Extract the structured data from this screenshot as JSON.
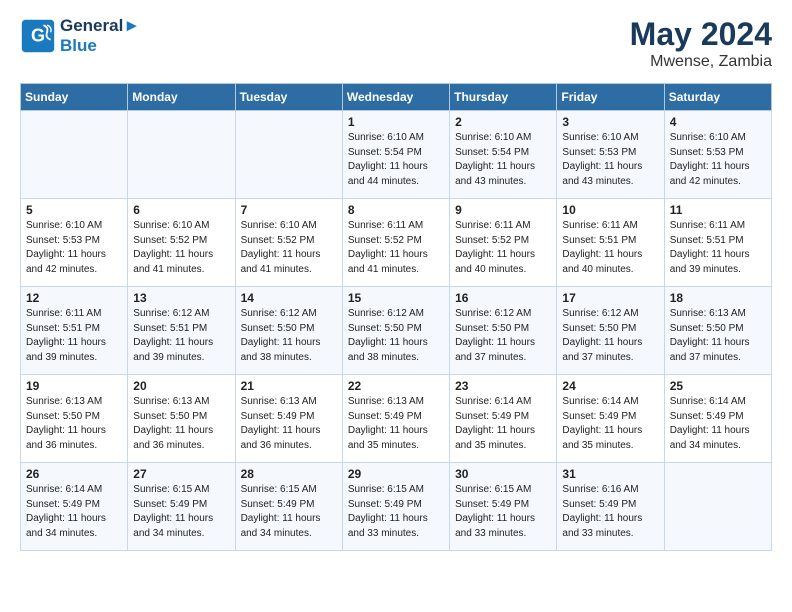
{
  "header": {
    "logo_line1": "General",
    "logo_line2": "Blue",
    "month": "May 2024",
    "location": "Mwense, Zambia"
  },
  "weekdays": [
    "Sunday",
    "Monday",
    "Tuesday",
    "Wednesday",
    "Thursday",
    "Friday",
    "Saturday"
  ],
  "weeks": [
    [
      {
        "day": "",
        "info": ""
      },
      {
        "day": "",
        "info": ""
      },
      {
        "day": "",
        "info": ""
      },
      {
        "day": "1",
        "info": "Sunrise: 6:10 AM\nSunset: 5:54 PM\nDaylight: 11 hours\nand 44 minutes."
      },
      {
        "day": "2",
        "info": "Sunrise: 6:10 AM\nSunset: 5:54 PM\nDaylight: 11 hours\nand 43 minutes."
      },
      {
        "day": "3",
        "info": "Sunrise: 6:10 AM\nSunset: 5:53 PM\nDaylight: 11 hours\nand 43 minutes."
      },
      {
        "day": "4",
        "info": "Sunrise: 6:10 AM\nSunset: 5:53 PM\nDaylight: 11 hours\nand 42 minutes."
      }
    ],
    [
      {
        "day": "5",
        "info": "Sunrise: 6:10 AM\nSunset: 5:53 PM\nDaylight: 11 hours\nand 42 minutes."
      },
      {
        "day": "6",
        "info": "Sunrise: 6:10 AM\nSunset: 5:52 PM\nDaylight: 11 hours\nand 41 minutes."
      },
      {
        "day": "7",
        "info": "Sunrise: 6:10 AM\nSunset: 5:52 PM\nDaylight: 11 hours\nand 41 minutes."
      },
      {
        "day": "8",
        "info": "Sunrise: 6:11 AM\nSunset: 5:52 PM\nDaylight: 11 hours\nand 41 minutes."
      },
      {
        "day": "9",
        "info": "Sunrise: 6:11 AM\nSunset: 5:52 PM\nDaylight: 11 hours\nand 40 minutes."
      },
      {
        "day": "10",
        "info": "Sunrise: 6:11 AM\nSunset: 5:51 PM\nDaylight: 11 hours\nand 40 minutes."
      },
      {
        "day": "11",
        "info": "Sunrise: 6:11 AM\nSunset: 5:51 PM\nDaylight: 11 hours\nand 39 minutes."
      }
    ],
    [
      {
        "day": "12",
        "info": "Sunrise: 6:11 AM\nSunset: 5:51 PM\nDaylight: 11 hours\nand 39 minutes."
      },
      {
        "day": "13",
        "info": "Sunrise: 6:12 AM\nSunset: 5:51 PM\nDaylight: 11 hours\nand 39 minutes."
      },
      {
        "day": "14",
        "info": "Sunrise: 6:12 AM\nSunset: 5:50 PM\nDaylight: 11 hours\nand 38 minutes."
      },
      {
        "day": "15",
        "info": "Sunrise: 6:12 AM\nSunset: 5:50 PM\nDaylight: 11 hours\nand 38 minutes."
      },
      {
        "day": "16",
        "info": "Sunrise: 6:12 AM\nSunset: 5:50 PM\nDaylight: 11 hours\nand 37 minutes."
      },
      {
        "day": "17",
        "info": "Sunrise: 6:12 AM\nSunset: 5:50 PM\nDaylight: 11 hours\nand 37 minutes."
      },
      {
        "day": "18",
        "info": "Sunrise: 6:13 AM\nSunset: 5:50 PM\nDaylight: 11 hours\nand 37 minutes."
      }
    ],
    [
      {
        "day": "19",
        "info": "Sunrise: 6:13 AM\nSunset: 5:50 PM\nDaylight: 11 hours\nand 36 minutes."
      },
      {
        "day": "20",
        "info": "Sunrise: 6:13 AM\nSunset: 5:50 PM\nDaylight: 11 hours\nand 36 minutes."
      },
      {
        "day": "21",
        "info": "Sunrise: 6:13 AM\nSunset: 5:49 PM\nDaylight: 11 hours\nand 36 minutes."
      },
      {
        "day": "22",
        "info": "Sunrise: 6:13 AM\nSunset: 5:49 PM\nDaylight: 11 hours\nand 35 minutes."
      },
      {
        "day": "23",
        "info": "Sunrise: 6:14 AM\nSunset: 5:49 PM\nDaylight: 11 hours\nand 35 minutes."
      },
      {
        "day": "24",
        "info": "Sunrise: 6:14 AM\nSunset: 5:49 PM\nDaylight: 11 hours\nand 35 minutes."
      },
      {
        "day": "25",
        "info": "Sunrise: 6:14 AM\nSunset: 5:49 PM\nDaylight: 11 hours\nand 34 minutes."
      }
    ],
    [
      {
        "day": "26",
        "info": "Sunrise: 6:14 AM\nSunset: 5:49 PM\nDaylight: 11 hours\nand 34 minutes."
      },
      {
        "day": "27",
        "info": "Sunrise: 6:15 AM\nSunset: 5:49 PM\nDaylight: 11 hours\nand 34 minutes."
      },
      {
        "day": "28",
        "info": "Sunrise: 6:15 AM\nSunset: 5:49 PM\nDaylight: 11 hours\nand 34 minutes."
      },
      {
        "day": "29",
        "info": "Sunrise: 6:15 AM\nSunset: 5:49 PM\nDaylight: 11 hours\nand 33 minutes."
      },
      {
        "day": "30",
        "info": "Sunrise: 6:15 AM\nSunset: 5:49 PM\nDaylight: 11 hours\nand 33 minutes."
      },
      {
        "day": "31",
        "info": "Sunrise: 6:16 AM\nSunset: 5:49 PM\nDaylight: 11 hours\nand 33 minutes."
      },
      {
        "day": "",
        "info": ""
      }
    ]
  ]
}
